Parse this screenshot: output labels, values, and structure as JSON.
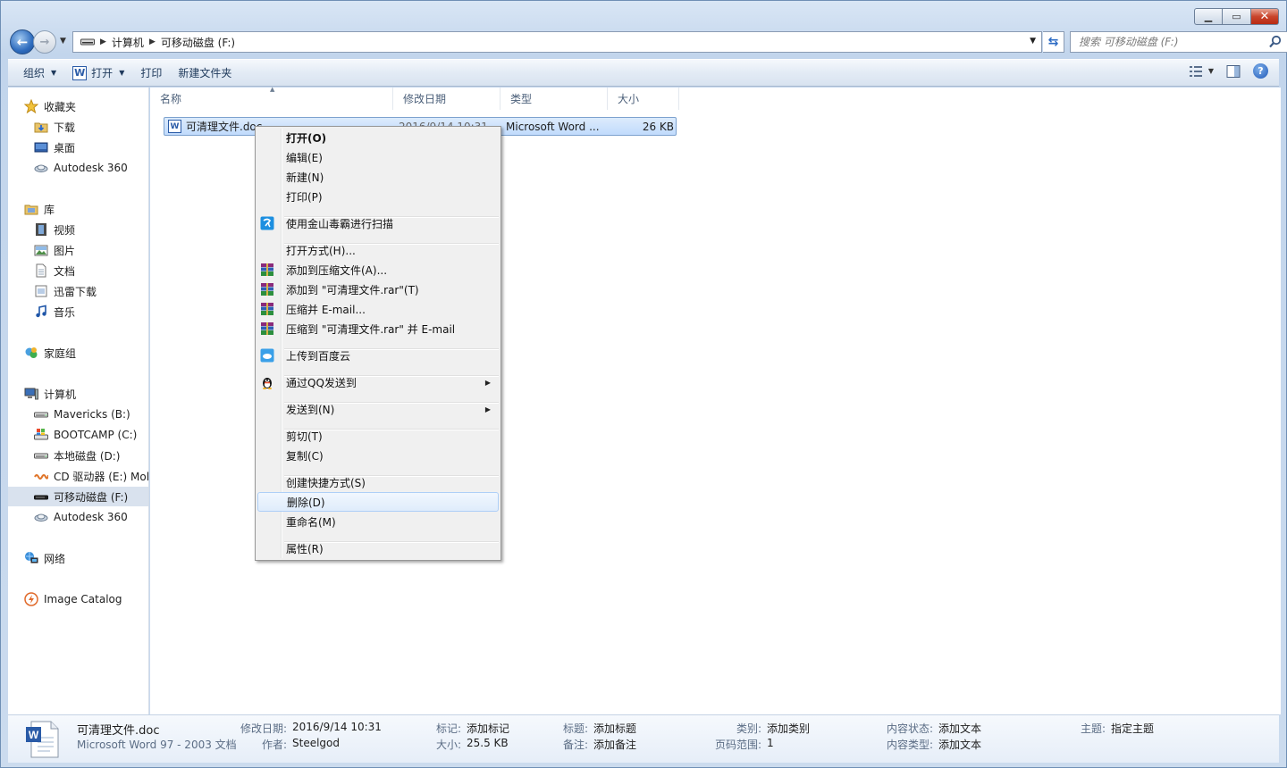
{
  "nav": {
    "breadcrumbs": [
      "计算机",
      "可移动磁盘 (F:)"
    ],
    "search_placeholder": "搜索 可移动磁盘 (F:)"
  },
  "toolbar": {
    "organize": "组织",
    "open": "打开",
    "print": "打印",
    "new_folder": "新建文件夹"
  },
  "sidebar": {
    "items": [
      {
        "label": "收藏夹",
        "icon": "star-icon"
      },
      {
        "label": "下载",
        "icon": "downloads-folder-icon"
      },
      {
        "label": "桌面",
        "icon": "desktop-icon"
      },
      {
        "label": "Autodesk 360",
        "icon": "cloud-drive-icon"
      },
      {
        "label": "库",
        "icon": "library-icon"
      },
      {
        "label": "视频",
        "icon": "video-icon"
      },
      {
        "label": "图片",
        "icon": "pictures-icon"
      },
      {
        "label": "文档",
        "icon": "documents-icon"
      },
      {
        "label": "迅雷下载",
        "icon": "xunlei-download-icon"
      },
      {
        "label": "音乐",
        "icon": "music-icon"
      },
      {
        "label": "家庭组",
        "icon": "homegroup-icon"
      },
      {
        "label": "计算机",
        "icon": "computer-icon"
      },
      {
        "label": "Mavericks (B:)",
        "icon": "drive-icon"
      },
      {
        "label": "BOOTCAMP (C:)",
        "icon": "system-drive-icon"
      },
      {
        "label": "本地磁盘 (D:)",
        "icon": "drive-icon"
      },
      {
        "label": "CD 驱动器 (E:) Mol",
        "icon": "cd-drive-icon"
      },
      {
        "label": "可移动磁盘 (F:)",
        "icon": "removable-drive-icon"
      },
      {
        "label": "Autodesk 360",
        "icon": "cloud-drive-icon"
      },
      {
        "label": "网络",
        "icon": "network-icon"
      },
      {
        "label": "Image Catalog",
        "icon": "image-catalog-icon"
      }
    ]
  },
  "columns": [
    "名称",
    "修改日期",
    "类型",
    "大小"
  ],
  "file": {
    "name": "可清理文件.doc",
    "date": "2016/9/14 10:31",
    "type": "Microsoft Word ...",
    "size": "26 KB"
  },
  "context_menu": {
    "items": [
      {
        "label": "打开(O)"
      },
      {
        "label": "编辑(E)"
      },
      {
        "label": "新建(N)"
      },
      {
        "label": "打印(P)"
      },
      {
        "label": "使用金山毒霸进行扫描",
        "icon": "duba-scan-icon"
      },
      {
        "label": "打开方式(H)..."
      },
      {
        "label": "添加到压缩文件(A)...",
        "icon": "winrar-icon"
      },
      {
        "label": "添加到 \"可清理文件.rar\"(T)",
        "icon": "winrar-icon"
      },
      {
        "label": "压缩并 E-mail...",
        "icon": "winrar-icon"
      },
      {
        "label": "压缩到 \"可清理文件.rar\" 并 E-mail",
        "icon": "winrar-icon"
      },
      {
        "label": "上传到百度云",
        "icon": "baidu-cloud-icon"
      },
      {
        "label": "通过QQ发送到",
        "icon": "qq-icon"
      },
      {
        "label": "发送到(N)"
      },
      {
        "label": "剪切(T)"
      },
      {
        "label": "复制(C)"
      },
      {
        "label": "创建快捷方式(S)"
      },
      {
        "label": "删除(D)"
      },
      {
        "label": "重命名(M)"
      },
      {
        "label": "属性(R)"
      }
    ]
  },
  "details": {
    "filename": "可清理文件.doc",
    "filetype": "Microsoft Word 97 - 2003 文档",
    "fields": [
      {
        "label": "修改日期:",
        "value": "2016/9/14 10:31"
      },
      {
        "label": "作者:",
        "value": "Steelgod"
      },
      {
        "label": "标记:",
        "value": "添加标记"
      },
      {
        "label": "大小:",
        "value": "25.5 KB"
      },
      {
        "label": "标题:",
        "value": "添加标题"
      },
      {
        "label": "备注:",
        "value": "添加备注"
      },
      {
        "label": "类别:",
        "value": "添加类别"
      },
      {
        "label": "页码范围:",
        "value": "1"
      },
      {
        "label": "内容状态:",
        "value": "添加文本"
      },
      {
        "label": "内容类型:",
        "value": "添加文本"
      },
      {
        "label": "主题:",
        "value": "指定主题"
      }
    ]
  },
  "colors": {
    "selection": "#c1dbfc",
    "menu_bg": "#f0f0f0",
    "accent": "#2a5ba7"
  }
}
